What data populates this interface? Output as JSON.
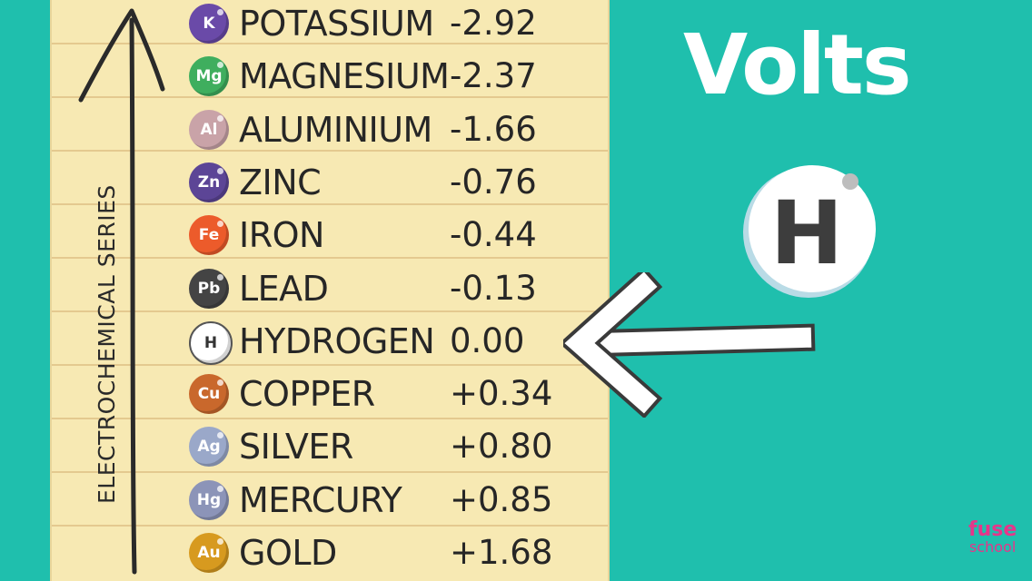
{
  "scale_label": "ELECTROCHEMICAL SERIES",
  "heading": "Volts",
  "featured_element": "H",
  "elements": [
    {
      "symbol": "K",
      "name": "POTASSIUM",
      "value": "-2.92",
      "color": "#6a4aa8"
    },
    {
      "symbol": "Mg",
      "name": "MAGNESIUM",
      "value": "-2.37",
      "color": "#3fae5e"
    },
    {
      "symbol": "Al",
      "name": "ALUMINIUM",
      "value": "-1.66",
      "color": "#c9a3a8"
    },
    {
      "symbol": "Zn",
      "name": "ZINC",
      "value": "-0.76",
      "color": "#5c4596"
    },
    {
      "symbol": "Fe",
      "name": "IRON",
      "value": "-0.44",
      "color": "#ec5b2b"
    },
    {
      "symbol": "Pb",
      "name": "LEAD",
      "value": "-0.13",
      "color": "#444444"
    },
    {
      "symbol": "H",
      "name": "HYDROGEN",
      "value": "0.00",
      "color": "#ffffff"
    },
    {
      "symbol": "Cu",
      "name": "COPPER",
      "value": "+0.34",
      "color": "#c9682c"
    },
    {
      "symbol": "Ag",
      "name": "SILVER",
      "value": "+0.80",
      "color": "#9aa8c9"
    },
    {
      "symbol": "Hg",
      "name": "MERCURY",
      "value": "+0.85",
      "color": "#8c94b8"
    },
    {
      "symbol": "Au",
      "name": "GOLD",
      "value": "+1.68",
      "color": "#d79a1f"
    }
  ],
  "logo": {
    "line1": "fuse",
    "line2": "school"
  }
}
